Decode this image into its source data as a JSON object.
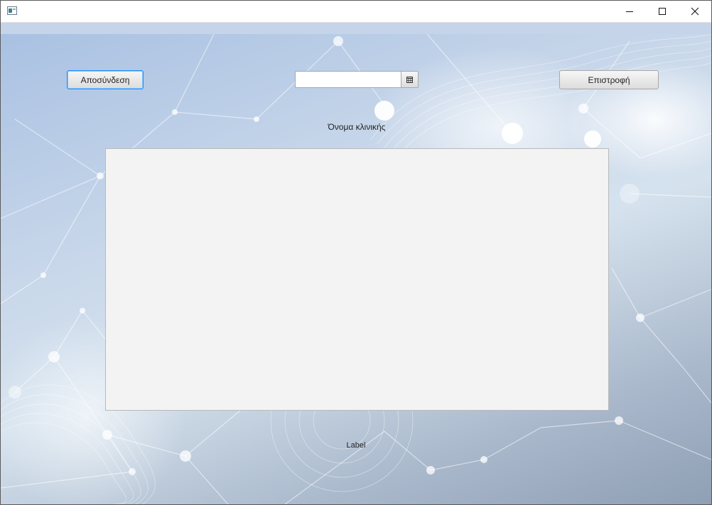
{
  "window": {
    "title": "",
    "controls": {
      "minimize": "minimize-icon",
      "maximize": "maximize-icon",
      "close": "close-icon"
    }
  },
  "toolbar": {
    "logout_label": "Αποσύνδεση",
    "back_label": "Επιστροφή",
    "date_value": "",
    "date_picker_icon": "calendar-icon"
  },
  "main": {
    "clinic_name_label": "Όνομα κλινικής",
    "list_items": []
  },
  "footer": {
    "label": "Label"
  },
  "colors": {
    "accent_focus": "#1e90ff",
    "panel_bg": "#f3f3f3",
    "menu_strip": "#c6d4ea"
  }
}
